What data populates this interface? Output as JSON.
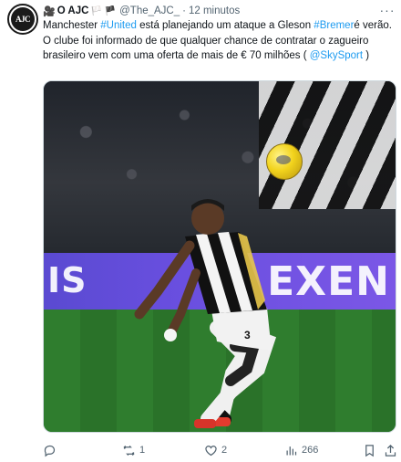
{
  "author": {
    "name": "O AJC",
    "name_prefix_icon": "movie-camera-icon",
    "flags": "🏳️ 🏴",
    "handle": "@The_AJC_",
    "separator": "·",
    "time": "12 minutos",
    "avatar_text": "AJC"
  },
  "tweet": {
    "segments": [
      {
        "text": "Manchester ",
        "type": "text"
      },
      {
        "text": "#United",
        "type": "hashtag"
      },
      {
        "text": " está planejando um ataque a Gleson ",
        "type": "text"
      },
      {
        "text": "#Bremer",
        "type": "hashtag"
      },
      {
        "text": "é verão. O clube foi informado de que qualquer chance de contratar o zagueiro brasileiro vem com uma oferta de mais de € 70 milhões ( ",
        "type": "text"
      },
      {
        "text": "@SkySport",
        "type": "mention"
      },
      {
        "text": " )",
        "type": "text"
      }
    ]
  },
  "media": {
    "ad_left": "IS",
    "ad_right": "EXEN",
    "player_number": "3"
  },
  "actions": {
    "reply_count": "",
    "retweet_count": "1",
    "like_count": "2",
    "views_count": "266"
  },
  "colors": {
    "accent": "#1d9bf0",
    "muted": "#536471",
    "text": "#0f1419"
  }
}
